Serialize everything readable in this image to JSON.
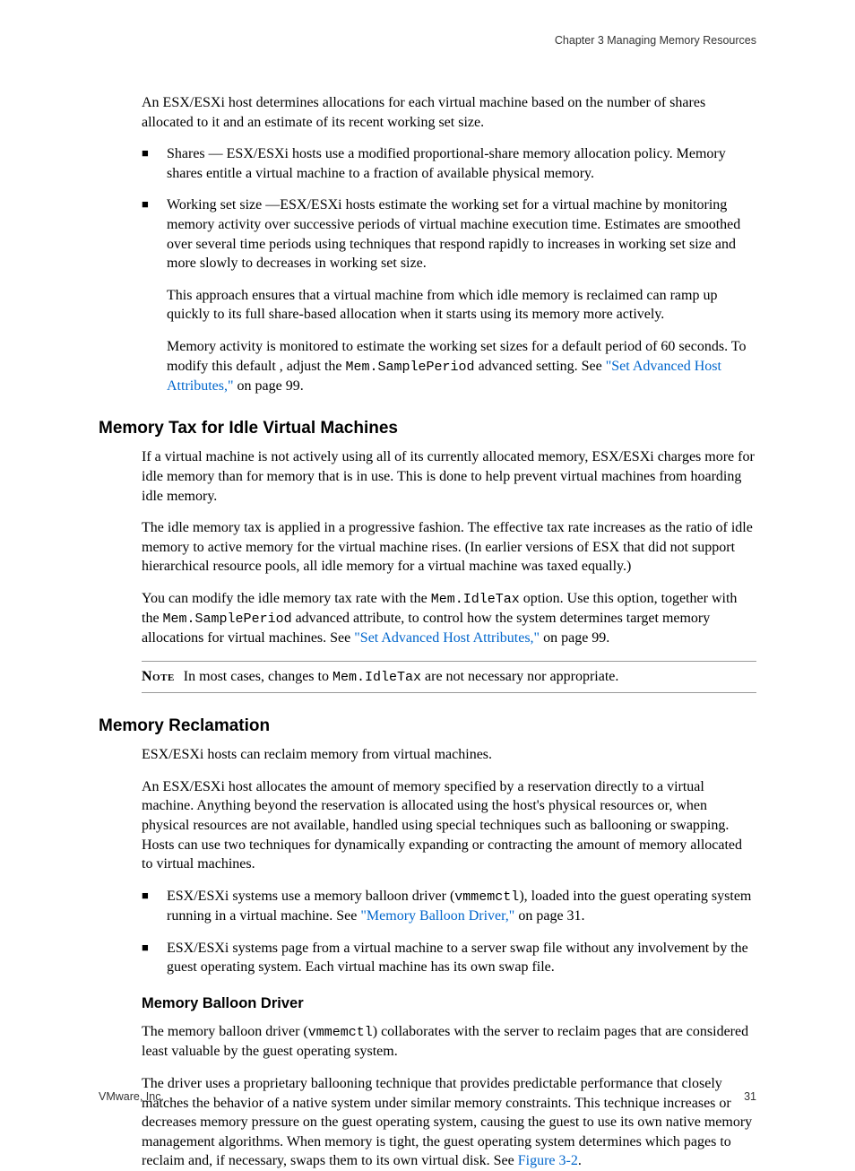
{
  "header": {
    "chapter_label": "Chapter 3 Managing Memory Resources"
  },
  "intro": {
    "p1": "An ESX/ESXi host determines allocations for each virtual machine based on the number of shares allocated to it and an estimate of its recent working set size."
  },
  "bullets_top": {
    "b1": "Shares — ESX/ESXi hosts use a modified proportional-share memory allocation policy. Memory shares entitle a virtual machine to a fraction of available physical memory.",
    "b2_p1": "Working set size —ESX/ESXi hosts estimate the working set for a virtual machine by monitoring memory activity over successive periods of virtual machine execution time. Estimates are smoothed over several time periods using techniques that respond rapidly to increases in working set size and more slowly to decreases in working set size.",
    "b2_p2": "This approach ensures that a virtual machine from which idle memory is reclaimed can ramp up quickly to its full share-based allocation when it starts using its memory more actively.",
    "b2_p3_a": "Memory activity is monitored to estimate the working set sizes for a default period of 60 seconds. To modify this default , adjust the ",
    "b2_p3_code": "Mem.SamplePeriod",
    "b2_p3_b": " advanced setting. See ",
    "b2_p3_link": "\"Set Advanced Host Attributes,\"",
    "b2_p3_c": " on page 99."
  },
  "sec_tax": {
    "heading": "Memory Tax for Idle Virtual Machines",
    "p1": "If a virtual machine is not actively using all of its currently allocated memory, ESX/ESXi charges more for idle memory than for memory that is in use. This is done to help prevent virtual machines from hoarding idle memory.",
    "p2": "The idle memory tax is applied in a progressive fashion. The effective tax rate increases as the ratio of idle memory to active memory for the virtual machine rises. (In earlier versions of ESX that did not support hierarchical resource pools, all idle memory for a virtual machine was taxed equally.)",
    "p3_a": "You can modify the idle memory tax rate with the ",
    "p3_code1": "Mem.IdleTax",
    "p3_b": " option. Use this option, together with the ",
    "p3_code2": "Mem.SamplePeriod",
    "p3_c": " advanced attribute, to control how the system determines target memory allocations for virtual machines. See ",
    "p3_link": "\"Set Advanced Host Attributes,\"",
    "p3_d": " on page 99."
  },
  "note": {
    "label": "Note",
    "text_a": "In most cases, changes to ",
    "text_code": "Mem.IdleTax",
    "text_b": " are not necessary nor appropriate."
  },
  "sec_reclaim": {
    "heading": "Memory Reclamation",
    "p1": "ESX/ESXi hosts can reclaim memory from virtual machines.",
    "p2": "An ESX/ESXi host allocates the amount of memory specified by a reservation directly to a virtual machine. Anything beyond the reservation is allocated using the host's physical resources or, when physical resources are not available, handled using special techniques such as ballooning or swapping. Hosts can use two techniques for dynamically expanding or contracting the amount of memory allocated to virtual machines.",
    "b1_a": "ESX/ESXi systems use a memory balloon driver (",
    "b1_code": "vmmemctl",
    "b1_b": "), loaded into the guest operating system running in a virtual machine. See ",
    "b1_link": "\"Memory Balloon Driver,\"",
    "b1_c": " on page 31.",
    "b2": "ESX/ESXi systems page from a virtual machine to a server swap file without any involvement by the guest operating system. Each virtual machine has its own swap file."
  },
  "sec_balloon": {
    "heading": "Memory Balloon Driver",
    "p1_a": "The memory balloon driver (",
    "p1_code": "vmmemctl",
    "p1_b": ") collaborates with the server to reclaim pages that are considered least valuable by the guest operating system.",
    "p2_a": "The driver uses a proprietary ballooning technique that provides predictable performance that closely matches the behavior of a native system under similar memory constraints. This technique increases or decreases memory pressure on the guest operating system, causing the guest to use its own native memory management algorithms. When memory is tight, the guest operating system determines which pages to reclaim and, if necessary, swaps them to its own virtual disk. See ",
    "p2_link": "Figure 3-2",
    "p2_b": "."
  },
  "footer": {
    "vendor": "VMware, Inc.",
    "page": "31"
  }
}
